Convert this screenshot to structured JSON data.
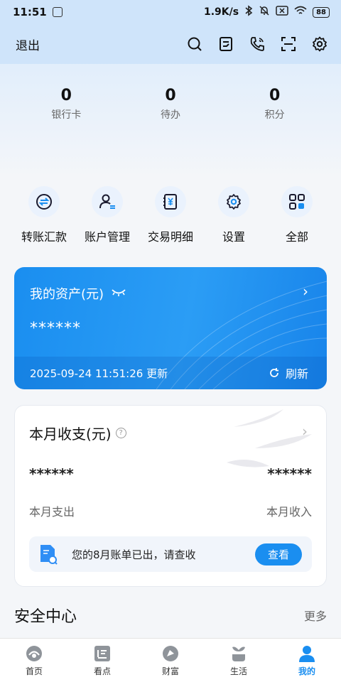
{
  "status_bar": {
    "time": "11:51",
    "speed": "1.9K/s",
    "battery": "88"
  },
  "header": {
    "logout_label": "退出"
  },
  "stats": [
    {
      "value": "0",
      "label": "银行卡"
    },
    {
      "value": "0",
      "label": "待办"
    },
    {
      "value": "0",
      "label": "积分"
    }
  ],
  "quick_actions": [
    {
      "label": "转账汇款",
      "icon": "transfer-icon"
    },
    {
      "label": "账户管理",
      "icon": "account-icon"
    },
    {
      "label": "交易明细",
      "icon": "ledger-icon"
    },
    {
      "label": "设置",
      "icon": "gear-icon"
    },
    {
      "label": "全部",
      "icon": "grid-icon"
    }
  ],
  "asset_card": {
    "title": "我的资产(元)",
    "masked_value": "******",
    "updated": "2025-09-24 11:51:26 更新",
    "refresh_label": "刷新"
  },
  "month_card": {
    "title": "本月收支(元)",
    "expense_value": "******",
    "income_value": "******",
    "expense_label": "本月支出",
    "income_label": "本月收入",
    "bill_text": "您的8月账单已出，请查收",
    "bill_button": "查看"
  },
  "security": {
    "title": "安全中心",
    "more": "更多"
  },
  "tabbar": [
    {
      "label": "首页",
      "icon": "home-icon"
    },
    {
      "label": "看点",
      "icon": "news-icon"
    },
    {
      "label": "财富",
      "icon": "wealth-icon"
    },
    {
      "label": "生活",
      "icon": "life-icon"
    },
    {
      "label": "我的",
      "icon": "profile-icon",
      "active": true
    }
  ],
  "colors": {
    "accent": "#1a8ef0",
    "header_bg": "#cfe4fa"
  }
}
